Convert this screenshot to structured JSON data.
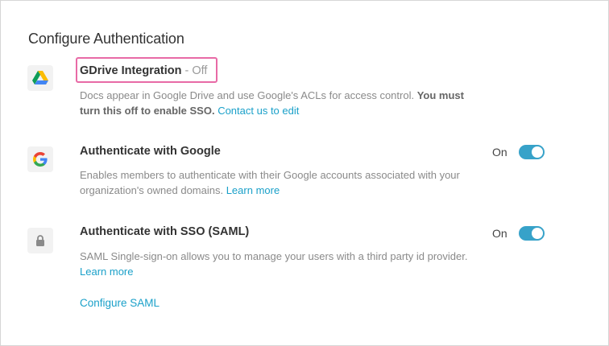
{
  "page": {
    "title": "Configure Authentication"
  },
  "gdrive": {
    "title": "GDrive Integration",
    "status": " - Off",
    "desc_text": "Docs appear in Google Drive and use Google's ACLs for access control. ",
    "desc_bold": "You must turn this off to enable SSO.",
    "link": "Contact us to edit"
  },
  "google": {
    "title": "Authenticate with Google",
    "toggle_label": "On",
    "desc_text": "Enables members to authenticate with their Google accounts associated with your organization's owned domains. ",
    "link": "Learn more"
  },
  "sso": {
    "title": "Authenticate with SSO (SAML)",
    "toggle_label": "On",
    "desc_text": "SAML Single-sign-on allows you to manage your users with a third party id provider. ",
    "link": "Learn more",
    "configure_link": "Configure SAML"
  },
  "icons": {
    "gdrive": "google-drive-icon",
    "google": "google-g-icon",
    "sso": "lock-icon"
  },
  "colors": {
    "accent": "#1aa0c9",
    "toggle_on": "#37a2c9",
    "highlight": "#e86aa6"
  }
}
